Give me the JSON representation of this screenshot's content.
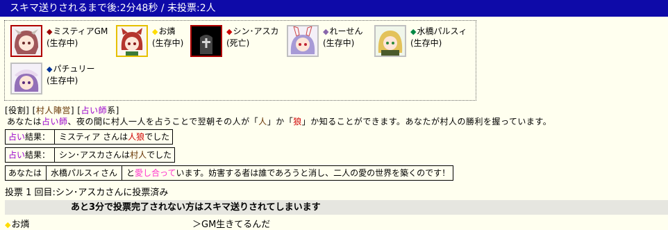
{
  "header": {
    "title": "スキマ送りされるまで後:2分48秒 / 未投票:2人"
  },
  "colors": {
    "header_bg": "#0e0aa8",
    "page_bg": "#ffffef",
    "wolf_red": "#d00000",
    "seer_purple": "#9900cc",
    "villager_brown": "#663300",
    "lover_pink": "#ff33cc",
    "warn_bg": "#e6e6e0"
  },
  "players": [
    {
      "mark": "◆",
      "mark_color": "#990000",
      "name": "ミスティアGM",
      "status": "(生存中)",
      "avatar_icon": "mystia-avatar-icon"
    },
    {
      "mark": "◆",
      "mark_color": "#ffdd00",
      "name": "お燐",
      "status": "(生存中)",
      "avatar_icon": "orin-avatar-icon"
    },
    {
      "mark": "◆",
      "mark_color": "#cc0000",
      "name": "シン･アスカ",
      "status": "(死亡)",
      "avatar_icon": "gravestone-icon"
    },
    {
      "mark": "◆",
      "mark_color": "#8866aa",
      "name": "れーせん",
      "status": "(生存中)",
      "avatar_icon": "reisen-avatar-icon"
    },
    {
      "mark": "◆",
      "mark_color": "#008844",
      "name": "水橋パルスィ",
      "status": "(生存中)",
      "avatar_icon": "parsee-avatar-icon"
    },
    {
      "mark": "◆",
      "mark_color": "#003399",
      "name": "パチュリー",
      "status": "(生存中)",
      "avatar_icon": "patchouli-avatar-icon"
    }
  ],
  "role": {
    "line_prefix": "[役割] [",
    "camp": "村人陣営",
    "line_mid": "] [",
    "role_name": "占い師",
    "line_suffix": "系]",
    "desc_1": "あなたは",
    "desc_role": "占い師",
    "desc_2": "、夜の間に村人一人を占うことで翌朝その人が「",
    "desc_human": "人",
    "desc_3": "」か「",
    "desc_wolf": "狼",
    "desc_4": "」か知ることができます。あなたが村人の勝利を握っています。"
  },
  "results": [
    {
      "label_a": "占い",
      "label_b": "結果：",
      "target": "ミスティア",
      "mid": "さんは",
      "verdict": "人狼",
      "end": "でした",
      "verdict_type": "wolf"
    },
    {
      "label_a": "占い",
      "label_b": "結果：",
      "target": "シン･アスカ",
      "mid": "さんは",
      "verdict": "村人",
      "end": "でした",
      "verdict_type": "villager"
    }
  ],
  "lover": {
    "prefix": "あなたは",
    "partner": "水橋パルスィさん",
    "mid": "と",
    "love": "愛し合って",
    "rest": "います。妨害する者は誰であろうと消し、二人の愛の世界を築くのです！"
  },
  "vote": {
    "text": "投票 1 回目:シン･アスカさんに投票済み"
  },
  "warning": {
    "text": "あと3分で投票完了されない方はスキマ送りされてしまいます"
  },
  "chat": {
    "speaker": "お燐",
    "message": "＞GM生きてるんだ"
  }
}
